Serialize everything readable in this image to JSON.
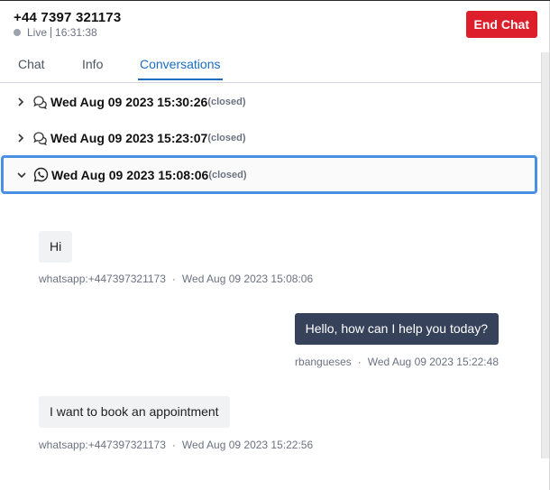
{
  "header": {
    "phone": "+44 7397 321173",
    "status_label": "Live",
    "status_time": "16:31:38",
    "end_chat_label": "End Chat"
  },
  "tabs": [
    {
      "label": "Chat",
      "active": false
    },
    {
      "label": "Info",
      "active": false
    },
    {
      "label": "Conversations",
      "active": true
    }
  ],
  "conversations": [
    {
      "date": "Wed Aug 09 2023 15:30:26",
      "status": "(closed)",
      "channel_icon": "chat-bubbles-icon",
      "expanded": false
    },
    {
      "date": "Wed Aug 09 2023 15:23:07",
      "status": "(closed)",
      "channel_icon": "chat-bubbles-icon",
      "expanded": false
    },
    {
      "date": "Wed Aug 09 2023 15:08:06",
      "status": "(closed)",
      "channel_icon": "whatsapp-icon",
      "expanded": true
    }
  ],
  "messages": [
    {
      "direction": "in",
      "text": "Hi",
      "sender": "whatsapp:+447397321173",
      "time": "Wed Aug 09 2023 15:08:06"
    },
    {
      "direction": "out",
      "text": "Hello, how can I help you today?",
      "sender": "rbangueses",
      "time": "Wed Aug 09 2023 15:22:48"
    },
    {
      "direction": "in",
      "text": "I want to book an appointment",
      "sender": "whatsapp:+447397321173",
      "time": "Wed Aug 09 2023 15:22:56"
    }
  ],
  "colors": {
    "accent": "#1a6fc4",
    "end_chat": "#dc1f2a",
    "outgoing_bubble": "#36425a",
    "incoming_bubble": "#f1f2f4",
    "selected_border": "#4a90e2"
  }
}
